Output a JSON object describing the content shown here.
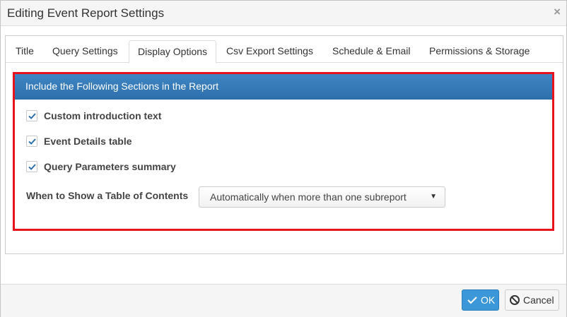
{
  "dialog": {
    "title": "Editing Event Report Settings",
    "close_glyph": "×"
  },
  "tabs": [
    {
      "label": "Title",
      "active": false
    },
    {
      "label": "Query Settings",
      "active": false
    },
    {
      "label": "Display Options",
      "active": true
    },
    {
      "label": "Csv Export Settings",
      "active": false
    },
    {
      "label": "Schedule & Email",
      "active": false
    },
    {
      "label": "Permissions & Storage",
      "active": false
    }
  ],
  "display_options": {
    "section_header": "Include the Following Sections in the Report",
    "checkboxes": [
      {
        "label": "Custom introduction text",
        "checked": true
      },
      {
        "label": "Event Details table",
        "checked": true
      },
      {
        "label": "Query Parameters summary",
        "checked": true
      }
    ],
    "toc_label": "When to Show a Table of Contents",
    "toc_selected": "Automatically when more than one subreport",
    "toc_caret": "▼"
  },
  "footer": {
    "ok_label": "OK",
    "cancel_label": "Cancel"
  },
  "colors": {
    "header_blue": "#2d6fab",
    "highlight_red": "#e8131c",
    "ok_blue": "#3c97d9",
    "check_blue": "#2d6fab"
  },
  "icons": {
    "close": "close-icon",
    "check": "checkmark-icon",
    "ok": "checkmark-icon",
    "cancel": "ban-icon",
    "caret": "caret-down-icon"
  }
}
